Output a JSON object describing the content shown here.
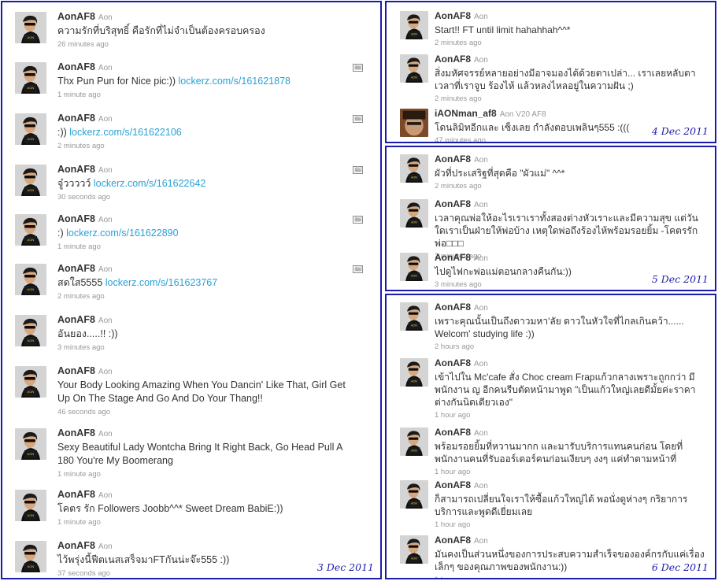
{
  "accent_color": "#1c1caa",
  "link_color": "#2aa1d6",
  "panels": [
    {
      "date": "3 Dec 2011",
      "tweets": [
        {
          "user": "AonAF8",
          "fullname": "Aon",
          "text": "ความรักที่บริสุทธิ์ คือรักที่ไม่จำเป็นต้องครอบครอง",
          "link": "",
          "time": "26 minutes ago",
          "icon": ""
        },
        {
          "user": "AonAF8",
          "fullname": "Aon",
          "text": "Thx Pun Pun for Nice pic:)) ",
          "link": "lockerz.com/s/161621878",
          "time": "1 minute ago",
          "icon": "photo-icon"
        },
        {
          "user": "AonAF8",
          "fullname": "Aon",
          "text": ":)) ",
          "link": "lockerz.com/s/161622106",
          "time": "2 minutes ago",
          "icon": "photo-icon"
        },
        {
          "user": "AonAF8",
          "fullname": "Aon",
          "text": "จู๋ววววว์ ",
          "link": "lockerz.com/s/161622642",
          "time": "30 seconds ago",
          "icon": "photo-icon"
        },
        {
          "user": "AonAF8",
          "fullname": "Aon",
          "text": ":) ",
          "link": "lockerz.com/s/161622890",
          "time": "1 minute ago",
          "icon": "photo-icon"
        },
        {
          "user": "AonAF8",
          "fullname": "Aon",
          "text": "สดใส5555 ",
          "link": "lockerz.com/s/161623767",
          "time": "2 minutes ago",
          "icon": "photo-icon"
        },
        {
          "user": "AonAF8",
          "fullname": "Aon",
          "text": "อันยอง.....!! :))",
          "link": "",
          "time": "3 minutes ago",
          "icon": ""
        },
        {
          "user": "AonAF8",
          "fullname": "Aon",
          "text": "Your Body Looking Amazing When You Dancin' Like That, Girl Get Up On The Stage And Go And Do Your Thang!!",
          "link": "",
          "time": "46 seconds ago",
          "icon": ""
        },
        {
          "user": "AonAF8",
          "fullname": "Aon",
          "text": "Sexy Beautiful Lady Wontcha Bring It Right Back, Go Head Pull A 180 You're My Boomerang",
          "link": "",
          "time": "1 minute ago",
          "icon": ""
        },
        {
          "user": "AonAF8",
          "fullname": "Aon",
          "text": "โคตร รัก Followers Joobb^^* Sweet Dream BabiE:))",
          "link": "",
          "time": "1 minute ago",
          "icon": ""
        },
        {
          "user": "AonAF8",
          "fullname": "Aon",
          "text": "ไว้พรุ่งนี้ฟีตเนสเสร็จมาFTกันน่ะจ๊ะ555 :))",
          "link": "",
          "time": "37 seconds ago",
          "icon": ""
        }
      ]
    },
    {
      "date": "4 Dec 2011",
      "tweets": [
        {
          "user": "AonAF8",
          "fullname": "Aon",
          "text": "Start!! FT until limit hahahhah^^*",
          "link": "",
          "time": "2 minutes ago",
          "icon": ""
        },
        {
          "user": "AonAF8",
          "fullname": "Aon",
          "text": "สิ่งมหัศจรรย์หลายอย่างมีอาจมองได้ด้วยตาเปล่า... เราเลยหลับตา เวลาที่เราจูบ ร้องไห้ แล้วหลงไหลอยู่ในความฝัน ;)",
          "link": "",
          "time": "2 minutes ago",
          "icon": ""
        },
        {
          "user": "iAONman_af8",
          "fullname": "Aon V20 AF8",
          "text": "โดนลิมิทอีกและ เซ็งเลย กำลังตอบเพลินๆ555 :(((",
          "link": "",
          "time": "47 minutes ago",
          "icon": ""
        }
      ]
    },
    {
      "date": "5 Dec 2011",
      "tweets": [
        {
          "user": "AonAF8",
          "fullname": "Aon",
          "text": "ผัวที่ประเสริฐที่สุดคือ \"ผัวแม่\" ^^*",
          "link": "",
          "time": "2 minutes ago",
          "icon": ""
        },
        {
          "user": "AonAF8",
          "fullname": "Aon",
          "text": "เวลาคุณพ่อให้อะไรเราเราทั้งสองต่างหัวเราะและมีความสุข แต่วันใดเราเป็นฝ่ายให้พ่อบ้าง เหตุใดพ่อถึงร้องไห้พร้อมรอยยิ้ม -โคตรรักพ่อ□□□",
          "link": "",
          "time": "2 minutes ago",
          "icon": ""
        },
        {
          "user": "AonAF8",
          "fullname": "Aon",
          "text": "ไปดูไฟกะพ่อแม่ตอนกลางคืนกัน:))",
          "link": "",
          "time": "3 minutes ago",
          "icon": ""
        }
      ]
    },
    {
      "date": "6 Dec 2011",
      "tweets": [
        {
          "user": "AonAF8",
          "fullname": "Aon",
          "text": "เพราะคุณนั้นเป็นถึงดาวมหา'ลัย ดาวในหัวใจที่ไกลเกินคว้า...... Welcom' studying life :))",
          "link": "",
          "time": "2 hours ago",
          "icon": ""
        },
        {
          "user": "AonAF8",
          "fullname": "Aon",
          "text": "เข้าไปใน Mc'cafe สั่ง Choc cream Frapแก้วกลางเพราะถูกกว่า มีพนักงาน ญ อีกคนรีบตัดหน้ามาพูด \"เป็นแก้วใหญ่เลยดีมั้ยค่ะราคาต่างกันนิดเดียวเอง\"",
          "link": "",
          "time": "1 hour ago",
          "icon": ""
        },
        {
          "user": "AonAF8",
          "fullname": "Aon",
          "text": "พร้อมรอยยิ้มที่หวานมากก และมารับบริการแทนคนก่อน โดยที่พนักงานคนที่รับออร์เดอร์คนก่อนเงียบๆ งงๆ แค่ทำตามหน้าที่",
          "link": "",
          "time": "1 hour ago",
          "icon": ""
        },
        {
          "user": "AonAF8",
          "fullname": "Aon",
          "text": "ก็สามารถเปลี่ยนใจเราให้ซื้อแก้วใหญ่ได้ พอนั่งดูห่างๆ กริยาการบริการและพูดดีเยี่ยมเลย",
          "link": "",
          "time": "1 hour ago",
          "icon": ""
        },
        {
          "user": "AonAF8",
          "fullname": "Aon",
          "text": "มันคงเป็นส่วนหนึ่งของการประสบความสำเร็จขององค์กรกับแค่เรื่องเล็กๆ ของคุณภาพของพนักงาน:))",
          "link": "",
          "time": "1 hour ago",
          "icon": ""
        }
      ]
    }
  ]
}
